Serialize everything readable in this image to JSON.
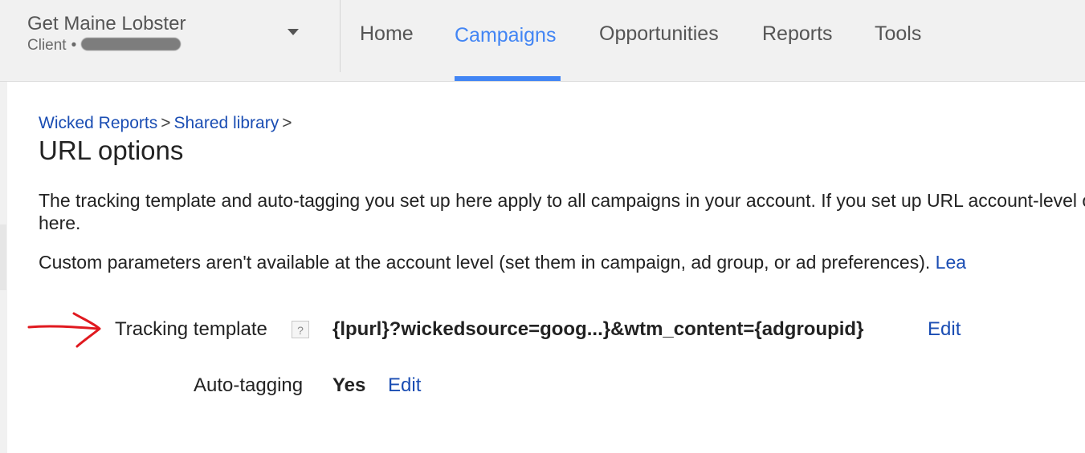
{
  "account": {
    "name": "Get Maine Lobster",
    "role": "Client",
    "separator": "•"
  },
  "nav": {
    "items": [
      {
        "label": "Home"
      },
      {
        "label": "Campaigns"
      },
      {
        "label": "Opportunities"
      },
      {
        "label": "Reports"
      },
      {
        "label": "Tools"
      }
    ],
    "active": "Campaigns",
    "accent_color": "#4285f4"
  },
  "breadcrumb": {
    "items": [
      {
        "label": "Wicked Reports"
      },
      {
        "label": "Shared library"
      }
    ],
    "separator": ">"
  },
  "page": {
    "title": "URL options",
    "description": "The tracking template and auto-tagging you set up here apply to all campaigns in your account. If you set up URL account-level options here.",
    "custom_params_text": "Custom parameters aren't available at the account level (set them in campaign, ad group, or ad preferences).",
    "learn_more_label": "Lea"
  },
  "settings": {
    "tracking_template": {
      "label": "Tracking template",
      "help_icon": "?",
      "value": "{lpurl}?wickedsource=goog...}&wtm_content={adgroupid}",
      "edit_label": "Edit"
    },
    "auto_tagging": {
      "label": "Auto-tagging",
      "value": "Yes",
      "edit_label": "Edit"
    }
  },
  "annotation": {
    "icon": "red-arrow-icon",
    "color": "#e0191f"
  },
  "link_color": "#1a4db3"
}
